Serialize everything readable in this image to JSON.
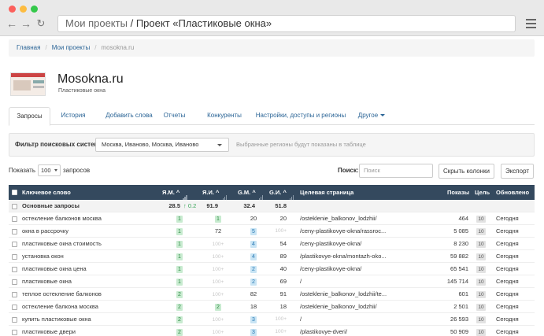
{
  "browser": {
    "url_prefix": "Мои проекты",
    "url_separator": "/",
    "url_title": "Проект «Пластиковые окна»"
  },
  "breadcrumb": [
    "Главная",
    "Мои проекты",
    "mosokna.ru"
  ],
  "project": {
    "title": "Mosokna.ru",
    "subtitle": "Пластиковые окна"
  },
  "tabs": [
    "Запросы",
    "История",
    "Добавить слова",
    "Отчеты",
    "Конкуренты",
    "Настройки, доступы и регионы",
    "Другое"
  ],
  "filter": {
    "label": "Фильтр поисковых систем",
    "selected": "Москва, Иваново, Москва, Иваново",
    "hint": "Выбранные регионы будут показаны в таблице"
  },
  "controls": {
    "show_label": "Показать",
    "show_value": "100",
    "show_suffix": "запросов",
    "search_label": "Поиск:",
    "search_placeholder": "Поиск",
    "hide_columns": "Скрыть колонки",
    "export": "Экспорт"
  },
  "table": {
    "headers": {
      "keyword": "Ключевое слово",
      "ym1": "Я.М.",
      "yi": "Я.И.",
      "gm": "G.M.",
      "gi": "G.И.",
      "page": "Целевая страница",
      "shows": "Показы",
      "goal": "Цель",
      "updated": "Обновлено"
    },
    "group": {
      "label": "Основные запросы",
      "ym1": "28.5",
      "ym1_delta": "↑ 0.2",
      "yi": "91.9",
      "gm": "32.4",
      "gi": "51.8"
    },
    "rows": [
      {
        "kw": "остекление балконов москва",
        "ym1": "1",
        "yi": "1",
        "gm": "20",
        "gi": "20",
        "page": "/osteklenie_balkonov_lodzhii/",
        "shows": "464",
        "goal": "10",
        "upd": "Сегодня"
      },
      {
        "kw": "окна в рассрочку",
        "ym1": "1",
        "yi": "72",
        "gm": "5",
        "gi": "100+",
        "page": "/ceny-plastikovye-okna/rassroc...",
        "shows": "5 085",
        "goal": "10",
        "upd": "Сегодня"
      },
      {
        "kw": "пластиковые окна стоимость",
        "ym1": "1",
        "yi": "100+",
        "gm": "4",
        "gi": "54",
        "page": "/ceny-plastikovye-okna/",
        "shows": "8 230",
        "goal": "10",
        "upd": "Сегодня"
      },
      {
        "kw": "установка окон",
        "ym1": "1",
        "yi": "100+",
        "gm": "4",
        "gi": "89",
        "page": "/plastikovye-okna/montazh-oko...",
        "shows": "59 882",
        "goal": "10",
        "upd": "Сегодня"
      },
      {
        "kw": "пластиковые окна цена",
        "ym1": "1",
        "yi": "100+",
        "gm": "2",
        "gi": "40",
        "page": "/ceny-plastikovye-okna/",
        "shows": "65 541",
        "goal": "10",
        "upd": "Сегодня"
      },
      {
        "kw": "пластиковые окна",
        "ym1": "1",
        "yi": "100+",
        "gm": "2",
        "gi": "69",
        "page": "/",
        "shows": "145 714",
        "goal": "10",
        "upd": "Сегодня"
      },
      {
        "kw": "теплое остекление балконов",
        "ym1": "2",
        "yi": "100+",
        "gm": "82",
        "gi": "91",
        "page": "/osteklenie_balkonov_lodzhii/te...",
        "shows": "601",
        "goal": "10",
        "upd": "Сегодня"
      },
      {
        "kw": "остекление балкона москва",
        "ym1": "2",
        "yi": "2",
        "gm": "18",
        "gi": "18",
        "page": "/osteklenie_balkonov_lodzhii/",
        "shows": "2 501",
        "goal": "10",
        "upd": "Сегодня"
      },
      {
        "kw": "купить пластиковые окна",
        "ym1": "2",
        "yi": "100+",
        "gm": "3",
        "gi": "100+",
        "page": "/",
        "shows": "26 593",
        "goal": "10",
        "upd": "Сегодня"
      },
      {
        "kw": "пластиковые двери",
        "ym1": "2",
        "yi": "100+",
        "gm": "3",
        "gi": "100+",
        "page": "/plastikovye-dveri/",
        "shows": "50 909",
        "goal": "10",
        "upd": "Сегодня"
      }
    ]
  }
}
